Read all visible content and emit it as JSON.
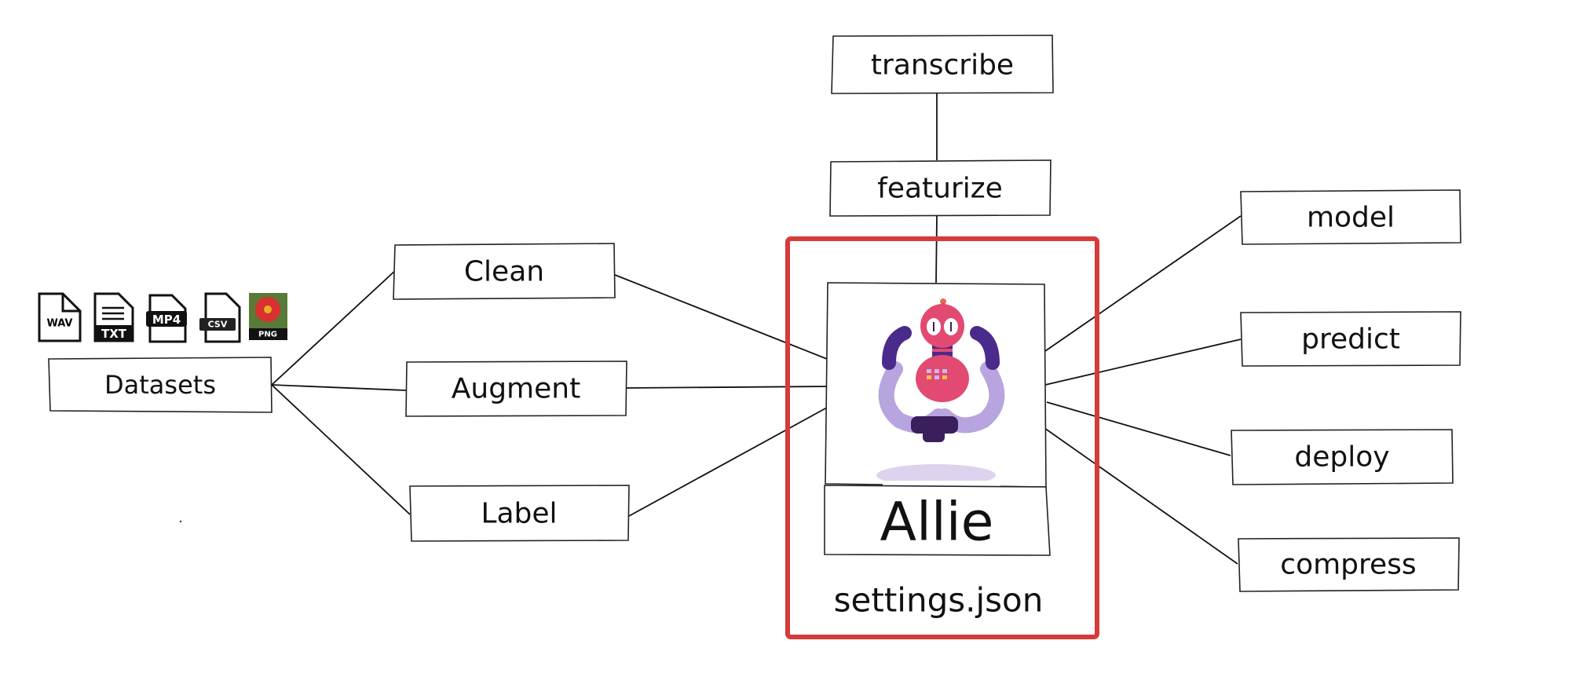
{
  "datasets": {
    "label": "Datasets",
    "file_types": [
      "WAV",
      "TXT",
      "MP4",
      "CSV",
      "PNG"
    ]
  },
  "preprocess": [
    "Clean",
    "Augment",
    "Label"
  ],
  "upstream": [
    "transcribe",
    "featurize"
  ],
  "core": {
    "name": "Allie",
    "config": "settings.json",
    "highlight_color": "#d63a3a"
  },
  "outputs": [
    "model",
    "predict",
    "deploy",
    "compress"
  ],
  "icons": [
    "wav-file-icon",
    "txt-file-icon",
    "mp4-file-icon",
    "csv-file-icon",
    "png-file-icon",
    "robot-mascot"
  ]
}
